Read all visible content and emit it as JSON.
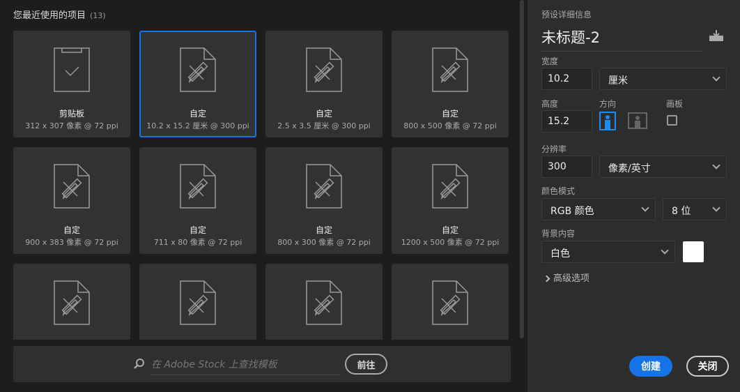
{
  "recent": {
    "title": "您最近使用的项目",
    "count": "(13)",
    "items": [
      {
        "name": "剪贴板",
        "size": "312 x 307 像素 @ 72 ppi",
        "icon": "clipboard"
      },
      {
        "name": "自定",
        "size": "10.2 x 15.2 厘米 @ 300 ppi",
        "icon": "document"
      },
      {
        "name": "自定",
        "size": "2.5 x 3.5 厘米 @ 300 ppi",
        "icon": "document"
      },
      {
        "name": "自定",
        "size": "800 x 500 像素 @ 72 ppi",
        "icon": "document"
      },
      {
        "name": "自定",
        "size": "900 x 383 像素 @ 72 ppi",
        "icon": "document"
      },
      {
        "name": "自定",
        "size": "711 x 80 像素 @ 72 ppi",
        "icon": "document"
      },
      {
        "name": "自定",
        "size": "800 x 300 像素 @ 72 ppi",
        "icon": "document"
      },
      {
        "name": "自定",
        "size": "1200 x 500 像素 @ 72 ppi",
        "icon": "document"
      },
      {
        "name": "",
        "size": "",
        "icon": "document"
      },
      {
        "name": "",
        "size": "",
        "icon": "document"
      },
      {
        "name": "",
        "size": "",
        "icon": "document"
      },
      {
        "name": "",
        "size": "",
        "icon": "document"
      }
    ]
  },
  "stock": {
    "placeholder": "在 Adobe Stock 上查找模板",
    "go": "前往"
  },
  "preset": {
    "header": "预设详细信息",
    "doc_name": "未标题-2",
    "width_label": "宽度",
    "width": "10.2",
    "width_unit": "厘米",
    "height_label": "高度",
    "height": "15.2",
    "orientation_label": "方向",
    "artboard_label": "画板",
    "resolution_label": "分辨率",
    "resolution": "300",
    "resolution_unit": "像素/英寸",
    "color_mode_label": "颜色模式",
    "color_mode": "RGB 颜色",
    "bit_depth": "8 位",
    "bg_label": "背景内容",
    "bg": "白色",
    "bg_color": "#ffffff",
    "advanced": "高级选项",
    "create": "创建",
    "close": "关闭"
  },
  "colors": {
    "accent": "#1473e6"
  }
}
